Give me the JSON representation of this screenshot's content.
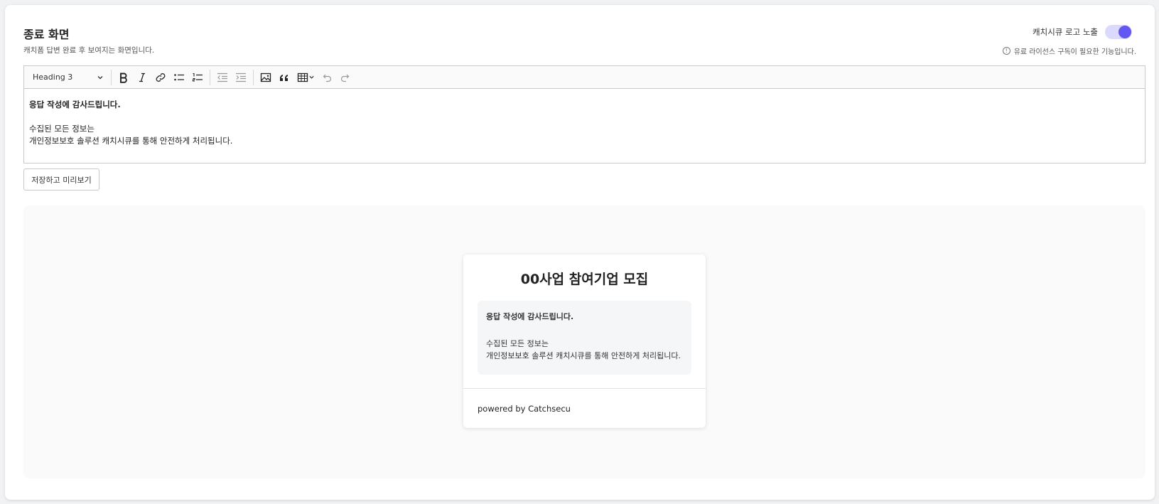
{
  "header": {
    "title": "종료 화면",
    "description": "캐치폼 답변 완료 후 보여지는 화면입니다.",
    "logo_toggle_label": "캐치시큐 로고 노출",
    "logo_toggle_on": true,
    "license_note": "유료 라이선스 구독이 필요한 기능입니다."
  },
  "toolbar": {
    "heading_value": "Heading 3",
    "icons": [
      "bold-icon",
      "italic-icon",
      "link-icon",
      "bulleted-list-icon",
      "numbered-list-icon",
      "outdent-icon",
      "indent-icon",
      "image-icon",
      "blockquote-icon",
      "table-icon",
      "undo-icon",
      "redo-icon"
    ]
  },
  "editor": {
    "line1": "응답 작성에 감사드립니다.",
    "line2": "수집된 모든 정보는",
    "line3": "개인정보보호 솔루션 캐치시큐를 통해 안전하게 처리됩니다."
  },
  "actions": {
    "save_preview_label": "저장하고 미리보기"
  },
  "preview": {
    "title": "00사업 참여기업 모집",
    "line1": "응답 작성에 감사드립니다.",
    "line2": "수집된 모든 정보는",
    "line3": "개인정보보호 솔루션 캐치시큐를 통해 안전하게 처리됩니다.",
    "powered_by": "powered by Catchsecu"
  },
  "colors": {
    "accent": "#6257f0",
    "toggle_track": "#dcdafc"
  }
}
